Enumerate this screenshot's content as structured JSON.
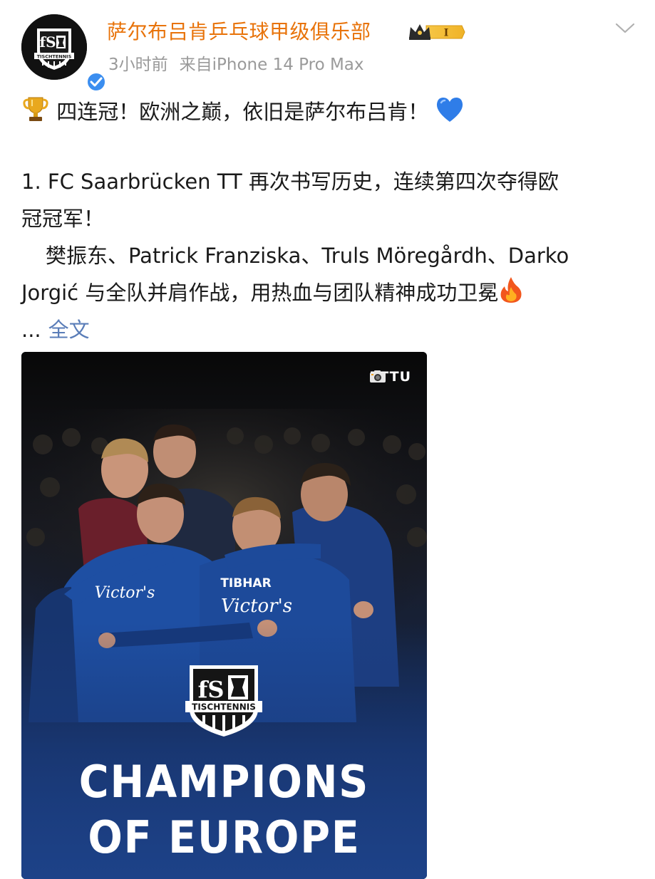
{
  "header": {
    "user_name": "萨尔布吕肯乒乓球甲级俱乐部",
    "vip_level": "I",
    "time_ago": "3小时前",
    "source": "来自iPhone 14 Pro Max",
    "avatar_text": "TISCHTENNIS"
  },
  "post": {
    "line1": "四连冠！欧洲之巅，依旧是萨尔布吕肯！",
    "para2_line1": "1. FC Saarbrücken TT 再次书写历史，连续第四次夺得欧",
    "para2_line2": "冠冠军！",
    "para3_line1": "樊振东、Patrick Franziska、Truls Möregårdh、Darko",
    "para3_line2": "Jorgić 与全队并肩作战，用热血与团队精神成功卫冕",
    "ellipsis": "...",
    "full_text_link": "全文"
  },
  "photo": {
    "credit": "ETTU",
    "logo_text": "TISCHTENNIS",
    "headline_1": "CHAMPIONS",
    "headline_2": "OF EUROPE",
    "jersey_sponsor_1": "TIBHAR",
    "jersey_sponsor_2": "Victor's"
  },
  "colors": {
    "user_name": "#e8730a",
    "meta": "#9a9a9a",
    "link": "#5a7db8",
    "verified": "#3b8ef0",
    "jersey_blue": "#1e4fa3"
  },
  "icons": {
    "trophy": "trophy-icon",
    "heart": "blue-heart-icon",
    "fire": "fire-icon",
    "camera": "camera-icon",
    "chevron": "chevron-down-icon"
  }
}
